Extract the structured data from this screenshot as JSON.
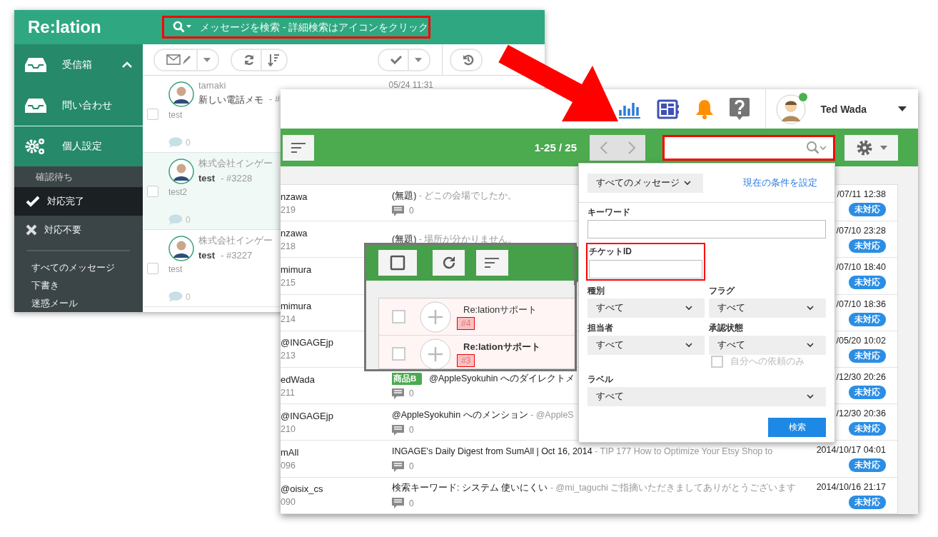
{
  "back_window": {
    "logo": "Re:lation",
    "search": {
      "placeholder": "メッセージを検索 - 詳細検索はアイコンをクリック",
      "highlighted": true
    },
    "sidebar": {
      "main_items": [
        {
          "label": "受信箱",
          "expanded": true
        },
        {
          "label": "問い合わせ",
          "expanded": false
        },
        {
          "label": "個人設定",
          "expanded": false
        }
      ],
      "sub_items": [
        {
          "label": "確認待ち",
          "selected": false
        },
        {
          "label": "対応完了",
          "selected": true
        },
        {
          "label": "対応不要",
          "selected": false
        }
      ],
      "folders": [
        "すべてのメッセージ",
        "下書き",
        "迷惑メール"
      ]
    },
    "messages": [
      {
        "sender": "tamaki",
        "subject": "新しい電話メモ",
        "suffix": "- #",
        "preview": "test",
        "comments": "0",
        "time": "05/24 11:31",
        "selected": false,
        "unread": false,
        "checked": false
      },
      {
        "sender": "株式会社インゲー",
        "subject": "test",
        "suffix": "- #3228",
        "preview": "test2",
        "comments": "0",
        "selected": true,
        "unread": true,
        "checked": false
      },
      {
        "sender": "株式会社インゲー",
        "subject": "test",
        "suffix": "- #3227",
        "preview": "test",
        "comments": "0",
        "selected": false,
        "unread": true,
        "checked": false
      }
    ]
  },
  "front_window": {
    "user": {
      "name": "Ted Wada",
      "online": true
    },
    "toolbar": {
      "range": "1-25 / 25",
      "search": {
        "highlighted": true
      }
    },
    "messages": [
      {
        "sender": "nzawa",
        "number": "219",
        "subject": "(無題)",
        "snippet": " - どこの会場でしたか。",
        "comments": "0",
        "time": "/07/11 12:38",
        "status": "未対応"
      },
      {
        "sender": "nzawa",
        "number": "218",
        "subject": "(無題)",
        "snippet": " - 場所が分かりません。",
        "time": "/07/10 23:28",
        "status": "未対応"
      },
      {
        "sender": "mimura",
        "number": "215",
        "time": "/07/10 18:40",
        "status": "未対応"
      },
      {
        "sender": "mimura",
        "number": "214",
        "time": "/07/10 18:36",
        "status": "未対応"
      },
      {
        "sender": "@INGAGEjp",
        "number": "213",
        "time": "/05/20 10:02",
        "status": "未対応"
      },
      {
        "sender": "edWada",
        "number": "211",
        "tag": {
          "label": "商品B",
          "color": "#4caa4f"
        },
        "subject": "@AppleSyokuhin へのダイレクトメ",
        "comments": "0",
        "time": "/12/30 20:26",
        "status": "未対応"
      },
      {
        "sender": "@INGAGEjp",
        "number": "210",
        "subject": "@AppleSyokuhin へのメンション",
        "snippet": " - @AppleS",
        "comments": "0",
        "time": "/12/30 20:36",
        "status": "未対応"
      },
      {
        "sender": "mAll",
        "number": "096",
        "subject": "INGAGE's Daily Digest from SumAll | Oct 16, 2014",
        "snippet": " - TIP 177 How to Optimize Your Etsy Shop to",
        "comments": "0",
        "time": "2014/10/17 04:01",
        "status": "未対応"
      },
      {
        "sender": "@oisix_cs",
        "number": "090",
        "subject": "検索キーワード: システム 使いにくい",
        "snippet": " - @mi_taguchi ご指摘いただきましてありがとうございます",
        "comments": "0",
        "time": "2014/10/16 21:17",
        "status": "未対応"
      }
    ],
    "callout": {
      "items": [
        {
          "name": "Re:lationサポート",
          "number": "#4",
          "unread": false,
          "checked": false
        },
        {
          "name": "Re:lationサポート",
          "number": "#3",
          "unread": true,
          "checked": false
        }
      ]
    },
    "search_panel": {
      "scope": "すべてのメッセージ",
      "set_link": "現在の条件を設定",
      "keyword": {
        "label": "キーワード"
      },
      "ticket_id": {
        "label": "チケットID",
        "highlighted": true
      },
      "filters": [
        {
          "label": "種別",
          "value": "すべて"
        },
        {
          "label": "フラグ",
          "value": "すべて"
        },
        {
          "label": "担当者",
          "value": "すべて"
        },
        {
          "label": "承認状態",
          "value": "すべて"
        }
      ],
      "mine_only": {
        "label": "自分への依頼のみ",
        "checked": false,
        "disabled": true
      },
      "label_filter": {
        "label": "ラベル",
        "value": "すべて"
      },
      "button": "検索"
    }
  }
}
